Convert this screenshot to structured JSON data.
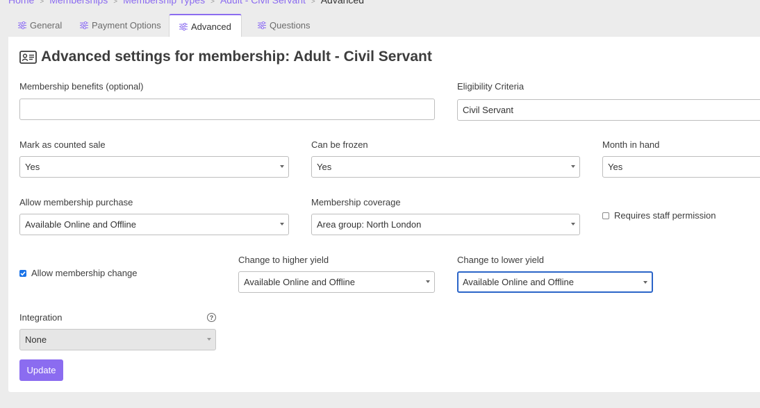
{
  "breadcrumb": {
    "items": [
      "Home",
      "Memberships",
      "Membership Types",
      "Adult - Civil Servant"
    ],
    "current": "Advanced"
  },
  "tabs": [
    {
      "label": "General",
      "icon": "sliders-icon"
    },
    {
      "label": "Payment Options",
      "icon": "sliders-icon"
    },
    {
      "label": "Advanced",
      "icon": "sliders-icon",
      "active": true
    },
    {
      "label": "Questions",
      "icon": "sliders-icon"
    }
  ],
  "page": {
    "title": "Advanced settings for membership: Adult - Civil Servant",
    "title_icon": "id-card-icon"
  },
  "form": {
    "benefits": {
      "label": "Membership benefits (optional)",
      "value": ""
    },
    "eligibility": {
      "label": "Eligibility Criteria",
      "value": "Civil Servant"
    },
    "counted_sale": {
      "label": "Mark as counted sale",
      "value": "Yes"
    },
    "can_be_frozen": {
      "label": "Can be frozen",
      "value": "Yes"
    },
    "month_in_hand": {
      "label": "Month in hand",
      "value": "Yes"
    },
    "allow_purchase": {
      "label": "Allow membership purchase",
      "value": "Available Online and Offline"
    },
    "coverage": {
      "label": "Membership coverage",
      "value": "Area group: North London"
    },
    "requires_staff": {
      "label": "Requires staff permission",
      "checked": false
    },
    "allow_change": {
      "label": "Allow membership change",
      "checked": true
    },
    "higher_yield": {
      "label": "Change to higher yield",
      "value": "Available Online and Offline"
    },
    "lower_yield": {
      "label": "Change to lower yield",
      "value": "Available Online and Offline"
    },
    "integration": {
      "label": "Integration",
      "value": "None",
      "help_icon": "question-circle-icon"
    },
    "update_label": "Update"
  },
  "colors": {
    "accent": "#8b6cf0",
    "focus": "#2a64c8",
    "checkbox": "#1a73e8"
  }
}
